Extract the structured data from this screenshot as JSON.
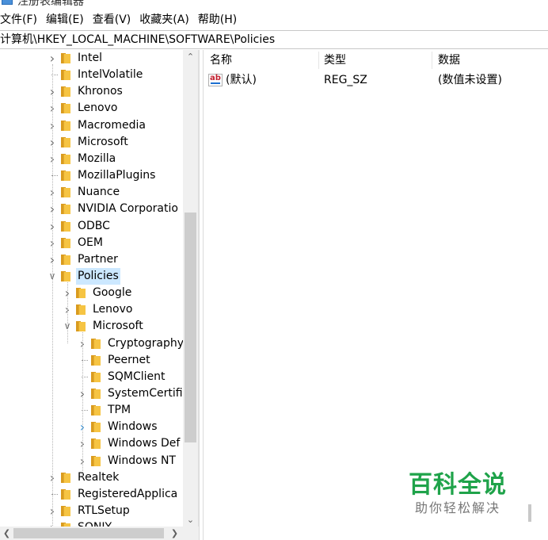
{
  "window": {
    "title": "注册表编辑器"
  },
  "menu": [
    "文件(F)",
    "编辑(E)",
    "查看(V)",
    "收藏夹(A)",
    "帮助(H)"
  ],
  "address": "计算机\\HKEY_LOCAL_MACHINE\\SOFTWARE\\Policies",
  "tree": [
    {
      "label": "Intel",
      "level": 0,
      "expander": "collapsed"
    },
    {
      "label": "IntelVolatile",
      "level": 0,
      "expander": "none"
    },
    {
      "label": "Khronos",
      "level": 0,
      "expander": "collapsed"
    },
    {
      "label": "Lenovo",
      "level": 0,
      "expander": "collapsed"
    },
    {
      "label": "Macromedia",
      "level": 0,
      "expander": "collapsed"
    },
    {
      "label": "Microsoft",
      "level": 0,
      "expander": "collapsed"
    },
    {
      "label": "Mozilla",
      "level": 0,
      "expander": "collapsed"
    },
    {
      "label": "MozillaPlugins",
      "level": 0,
      "expander": "none"
    },
    {
      "label": "Nuance",
      "level": 0,
      "expander": "collapsed"
    },
    {
      "label": "NVIDIA Corporatio",
      "level": 0,
      "expander": "collapsed"
    },
    {
      "label": "ODBC",
      "level": 0,
      "expander": "collapsed"
    },
    {
      "label": "OEM",
      "level": 0,
      "expander": "collapsed"
    },
    {
      "label": "Partner",
      "level": 0,
      "expander": "collapsed"
    },
    {
      "label": "Policies",
      "level": 0,
      "expander": "expanded",
      "selected": true
    },
    {
      "label": "Google",
      "level": 1,
      "expander": "collapsed"
    },
    {
      "label": "Lenovo",
      "level": 1,
      "expander": "collapsed"
    },
    {
      "label": "Microsoft",
      "level": 1,
      "expander": "expanded"
    },
    {
      "label": "Cryptography",
      "level": 2,
      "expander": "collapsed"
    },
    {
      "label": "Peernet",
      "level": 2,
      "expander": "none"
    },
    {
      "label": "SQMClient",
      "level": 2,
      "expander": "none"
    },
    {
      "label": "SystemCertifi",
      "level": 2,
      "expander": "collapsed"
    },
    {
      "label": "TPM",
      "level": 2,
      "expander": "none"
    },
    {
      "label": "Windows",
      "level": 2,
      "expander": "collapsed-hover"
    },
    {
      "label": "Windows Def",
      "level": 2,
      "expander": "collapsed"
    },
    {
      "label": "Windows NT",
      "level": 2,
      "expander": "collapsed"
    },
    {
      "label": "Realtek",
      "level": 0,
      "expander": "collapsed"
    },
    {
      "label": "RegisteredApplica",
      "level": 0,
      "expander": "none"
    },
    {
      "label": "RTLSetup",
      "level": 0,
      "expander": "collapsed"
    },
    {
      "label": "SONIY",
      "level": 0,
      "expander": "collapsed"
    }
  ],
  "values_table": {
    "headers": [
      "名称",
      "类型",
      "数据"
    ],
    "rows": [
      {
        "name": "(默认)",
        "type": "REG_SZ",
        "data": "(数值未设置)",
        "icon": "reg-string-icon"
      }
    ]
  },
  "watermark": {
    "main": "百科全说",
    "sub": "助你轻松解决",
    "color": "#1fa34a"
  },
  "colors": {
    "selection": "#cce8ff",
    "folder": "#f6c443",
    "hover_chevron": "#2f8fd8"
  }
}
